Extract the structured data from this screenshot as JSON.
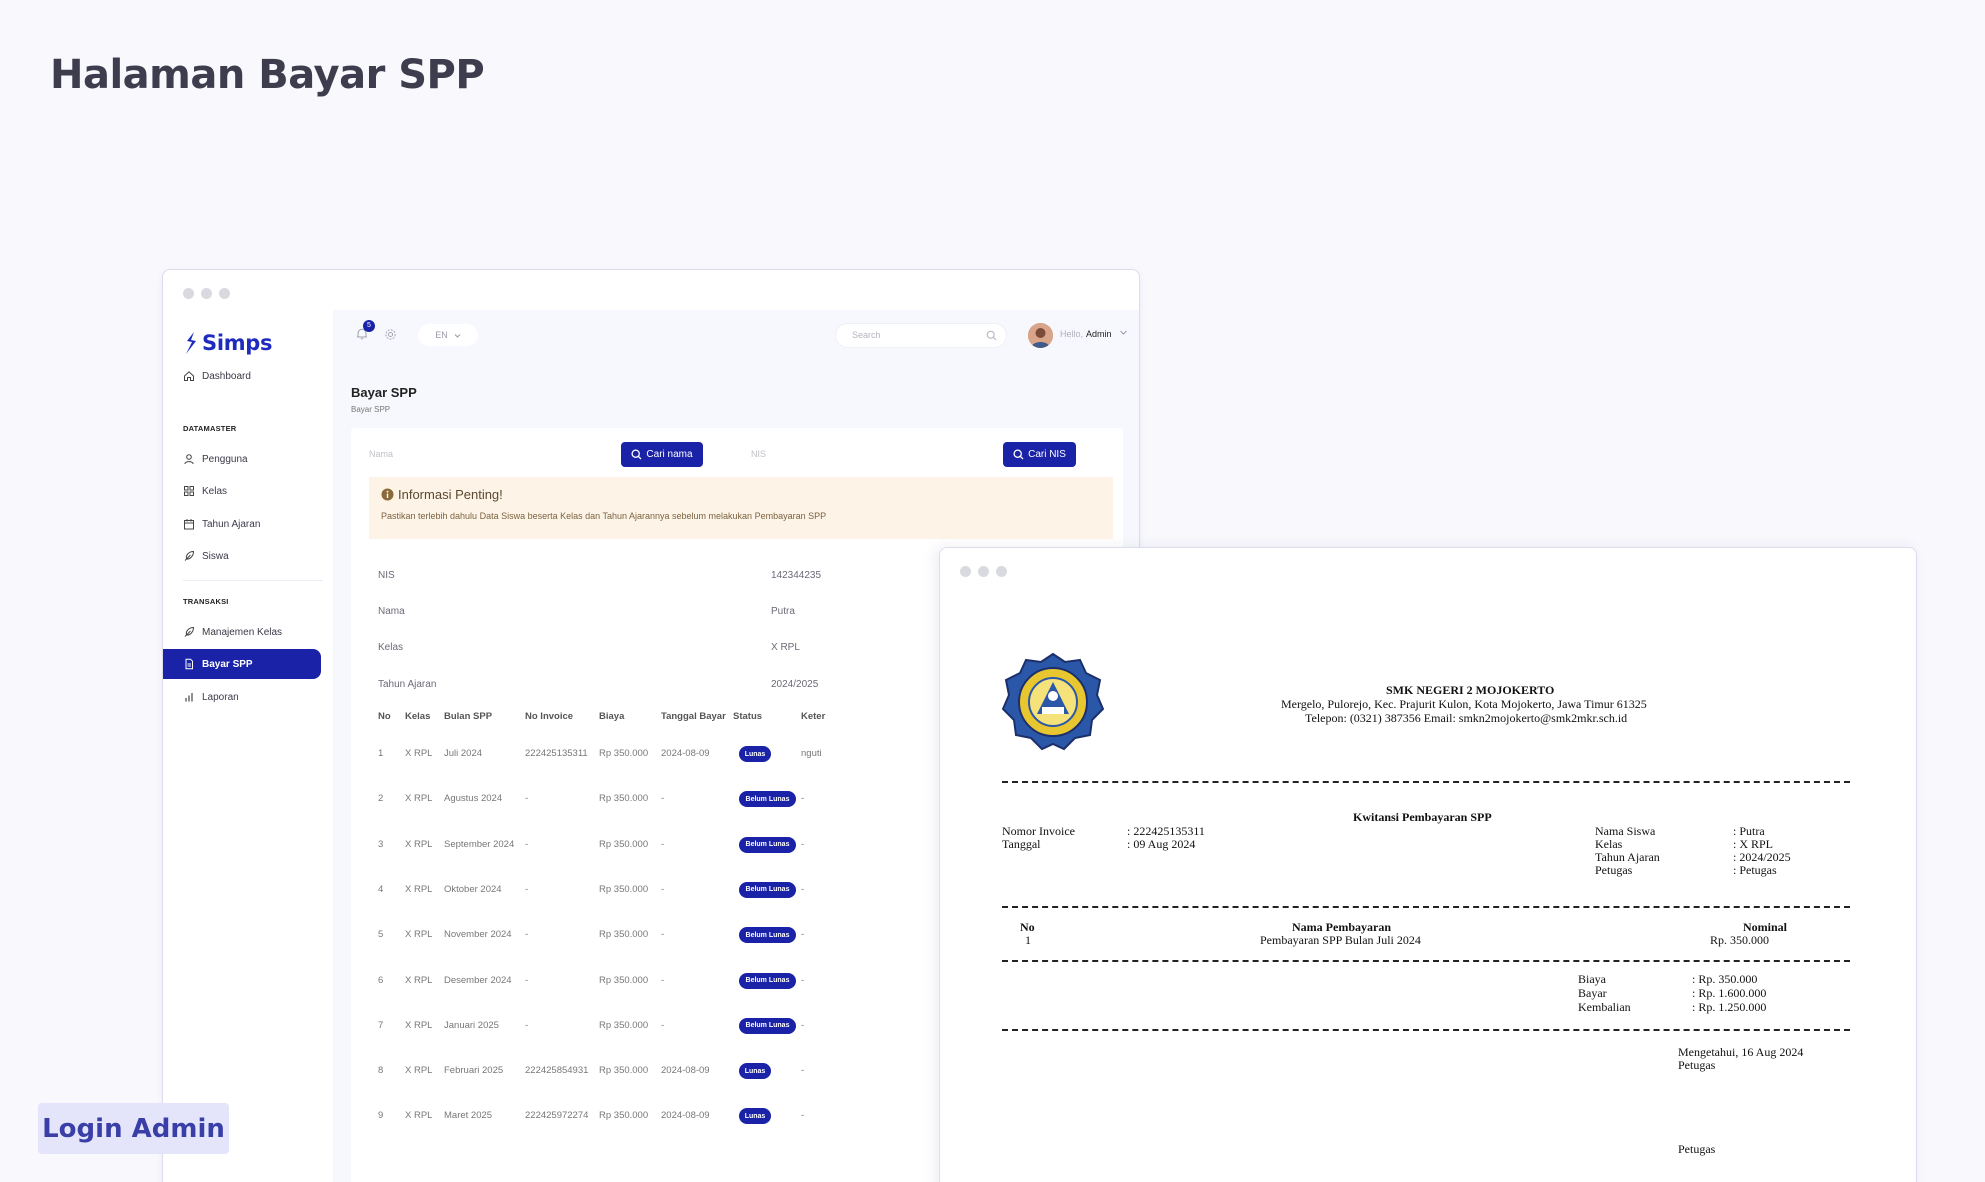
{
  "page_title": "Halaman Bayar SPP",
  "login_badge": "Login Admin",
  "app": {
    "brand": "Simps",
    "sidebar": {
      "dashboard": "Dashboard",
      "section_datamaster": "DATAMASTER",
      "pengguna": "Pengguna",
      "kelas": "Kelas",
      "tahun_ajaran": "Tahun Ajaran",
      "siswa": "Siswa",
      "section_transaksi": "TRANSAKSI",
      "manajemen_kelas": "Manajemen Kelas",
      "bayar_spp": "Bayar SPP",
      "laporan": "Laporan"
    },
    "topbar": {
      "notif_count": "5",
      "lang": "EN",
      "search_placeholder": "Search",
      "hello": "Hello,",
      "user": "Admin"
    },
    "page": {
      "title": "Bayar SPP",
      "breadcrumb": "Bayar SPP"
    },
    "form": {
      "nama_placeholder": "Nama",
      "cari_nama": "Cari nama",
      "nis_placeholder": "NIS",
      "cari_nis": "Cari NIS"
    },
    "info": {
      "title": "Informasi Penting!",
      "text": "Pastikan terlebih dahulu Data Siswa beserta Kelas dan Tahun Ajarannya sebelum melakukan Pembayaran SPP"
    },
    "student": {
      "nis_label": "NIS",
      "nis_value": "142344235",
      "nama_label": "Nama",
      "nama_value": "Putra",
      "kelas_label": "Kelas",
      "kelas_value": "X RPL",
      "tahun_label": "Tahun Ajaran",
      "tahun_value": "2024/2025"
    },
    "table": {
      "headers": [
        "No",
        "Kelas",
        "Bulan SPP",
        "No Invoice",
        "Biaya",
        "Tanggal Bayar",
        "Status",
        "Keter"
      ],
      "rows": [
        {
          "no": "1",
          "kelas": "X RPL",
          "bulan": "Juli 2024",
          "invoice": "222425135311",
          "biaya": "Rp 350.000",
          "tanggal": "2024-08-09",
          "status": "Lunas",
          "ket": "nguti"
        },
        {
          "no": "2",
          "kelas": "X RPL",
          "bulan": "Agustus 2024",
          "invoice": "-",
          "biaya": "Rp 350.000",
          "tanggal": "-",
          "status": "Belum Lunas",
          "ket": "-"
        },
        {
          "no": "3",
          "kelas": "X RPL",
          "bulan": "September 2024",
          "invoice": "-",
          "biaya": "Rp 350.000",
          "tanggal": "-",
          "status": "Belum Lunas",
          "ket": "-"
        },
        {
          "no": "4",
          "kelas": "X RPL",
          "bulan": "Oktober 2024",
          "invoice": "-",
          "biaya": "Rp 350.000",
          "tanggal": "-",
          "status": "Belum Lunas",
          "ket": "-"
        },
        {
          "no": "5",
          "kelas": "X RPL",
          "bulan": "November 2024",
          "invoice": "-",
          "biaya": "Rp 350.000",
          "tanggal": "-",
          "status": "Belum Lunas",
          "ket": "-"
        },
        {
          "no": "6",
          "kelas": "X RPL",
          "bulan": "Desember 2024",
          "invoice": "-",
          "biaya": "Rp 350.000",
          "tanggal": "-",
          "status": "Belum Lunas",
          "ket": "-"
        },
        {
          "no": "7",
          "kelas": "X RPL",
          "bulan": "Januari 2025",
          "invoice": "-",
          "biaya": "Rp 350.000",
          "tanggal": "-",
          "status": "Belum Lunas",
          "ket": "-"
        },
        {
          "no": "8",
          "kelas": "X RPL",
          "bulan": "Februari 2025",
          "invoice": "222425854931",
          "biaya": "Rp 350.000",
          "tanggal": "2024-08-09",
          "status": "Lunas",
          "ket": "-"
        },
        {
          "no": "9",
          "kelas": "X RPL",
          "bulan": "Maret 2025",
          "invoice": "222425972274",
          "biaya": "Rp 350.000",
          "tanggal": "2024-08-09",
          "status": "Lunas",
          "ket": "-"
        }
      ]
    }
  },
  "receipt": {
    "school": "SMK NEGERI 2 MOJOKERTO",
    "address": "Mergelo, Pulorejo, Kec. Prajurit Kulon, Kota Mojokerto, Jawa Timur 61325",
    "contact": "Telepon: (0321) 387356 Email: smkn2mojokerto@smk2mkr.sch.id",
    "title": "Kwitansi Pembayaran SPP",
    "nomor_invoice_label": "Nomor Invoice",
    "nomor_invoice": ": 222425135311",
    "tanggal_label": "Tanggal",
    "tanggal": ": 09 Aug 2024",
    "nama_siswa_label": "Nama Siswa",
    "nama_siswa": ": Putra",
    "kelas_label": "Kelas",
    "kelas": ": X RPL",
    "tahun_label": "Tahun Ajaran",
    "tahun": ": 2024/2025",
    "petugas_label": "Petugas",
    "petugas": ": Petugas",
    "col_no": "No",
    "col_nama": "Nama Pembayaran",
    "col_nominal": "Nominal",
    "item_no": "1",
    "item_nama": "Pembayaran SPP Bulan Juli 2024",
    "item_nominal": "Rp. 350.000",
    "biaya_label": "Biaya",
    "biaya": ": Rp. 350.000",
    "bayar_label": "Bayar",
    "bayar": ": Rp. 1.600.000",
    "kembalian_label": "Kembalian",
    "kembalian": ": Rp. 1.250.000",
    "mengetahui": "Mengetahui, 16 Aug 2024",
    "petugas_sign_title": "Petugas",
    "petugas_sign_name": "Petugas"
  },
  "colors": {
    "primary": "#1a22a8",
    "info_bg": "#fdf4e7"
  }
}
